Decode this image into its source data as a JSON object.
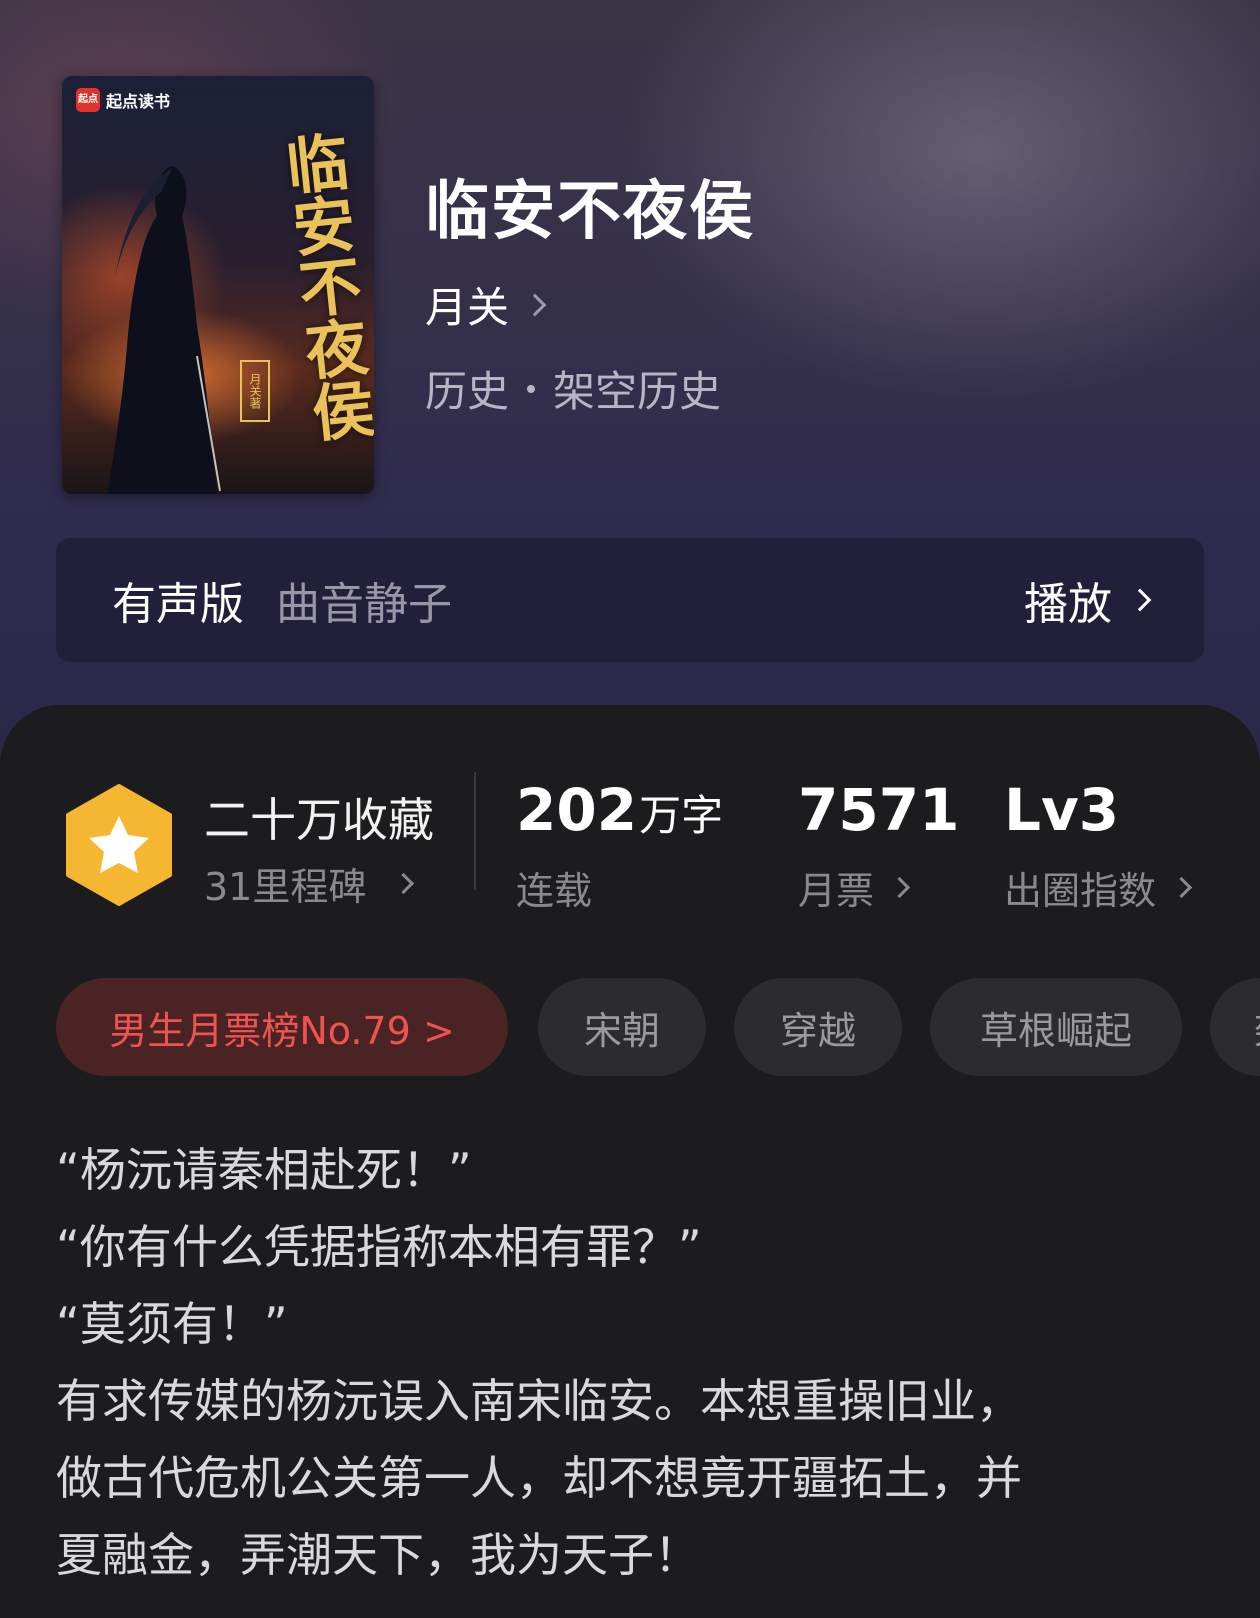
{
  "cover": {
    "publisher_logo_text": "起点读书",
    "publisher_logo_mark": "起点",
    "title_art": "临安不夜侯",
    "author_tag": "月关著"
  },
  "book": {
    "title": "临安不夜侯",
    "author": "月关",
    "genre": "历史",
    "subgenre": "架空历史"
  },
  "audio": {
    "label": "有声版",
    "narrator": "曲音静子",
    "play_label": "播放"
  },
  "stats": {
    "collect_title": "二十万收藏",
    "milestone": "31里程碑",
    "word_count": "202",
    "word_unit": "万字",
    "status": "连载",
    "monthly_votes": "7571",
    "monthly_votes_label": "月票",
    "level": "Lv3",
    "level_label": "出圈指数"
  },
  "tags": [
    "男生月票榜No.79 >",
    "宋朝",
    "穿越",
    "草根崛起",
    "架"
  ],
  "synopsis": [
    "“杨沅请秦相赴死！”",
    "“你有什么凭据指称本相有罪？”",
    "“莫须有！”",
    "有求传媒的杨沅误入南宋临安。本想重操旧业，",
    "做古代危机公关第一人，却不想竟开疆拓土，并",
    "夏融金，弄潮天下，我为天子！"
  ],
  "colors": {
    "accent_rank": "#ef5350",
    "badge_gold": "#f5b731",
    "card_bg": "#1c1c1e"
  }
}
